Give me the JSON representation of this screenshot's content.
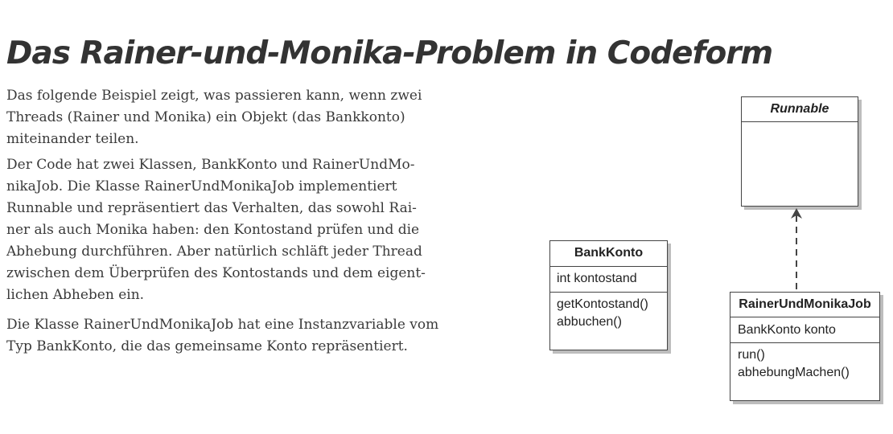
{
  "title": "Das Rainer-und-Monika-Problem in Codeform",
  "paragraphs": {
    "p1": [
      "Das folgende Beispiel zeigt, was passieren kann, wenn zwei",
      "Threads (Rainer und Monika) ein Objekt (das Bankkonto)",
      "miteinander teilen."
    ],
    "p2": [
      "Der Code hat zwei Klassen, BankKonto und RainerUndMo-",
      "nikaJob. Die Klasse RainerUndMonikaJob implementiert",
      "Runnable und repräsentiert das Verhalten, das sowohl Rai-",
      "ner als auch Monika haben: den Kontostand prüfen und die",
      "Abhebung durchführen. Aber natürlich schläft jeder Thread",
      "zwischen dem Überprüfen des Kontostands und dem eigent-",
      "lichen Abheben ein."
    ],
    "p3": [
      "Die Klasse RainerUndMonikaJob hat eine Instanzvariable vom",
      "Typ BankKonto, die das gemeinsame Konto repräsentiert."
    ]
  },
  "diagram": {
    "bankkonto": {
      "name": "BankKonto",
      "attributes": [
        "int kontostand"
      ],
      "methods": [
        "getKontostand()",
        "abbuchen()"
      ]
    },
    "runnable": {
      "name": "Runnable"
    },
    "job": {
      "name": "RainerUndMonikaJob",
      "attributes": [
        "BankKonto konto"
      ],
      "methods": [
        "run()",
        "abhebungMachen()"
      ]
    }
  }
}
